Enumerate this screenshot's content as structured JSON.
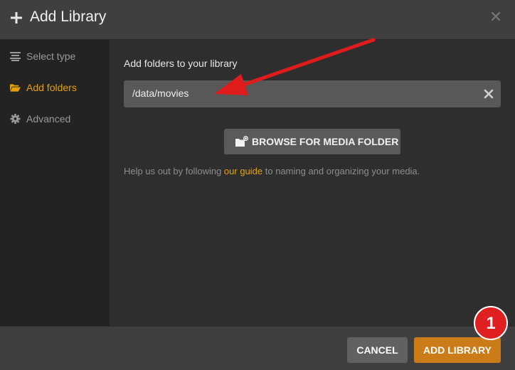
{
  "dialog": {
    "title": "Add Library",
    "title_icon": "plus-icon",
    "close_icon": "close-icon"
  },
  "sidebar": {
    "items": [
      {
        "label": "Select type",
        "icon": "list-icon",
        "active": false
      },
      {
        "label": "Add folders",
        "icon": "folder-open-icon",
        "active": true
      },
      {
        "label": "Advanced",
        "icon": "gear-icon",
        "active": false
      }
    ]
  },
  "main": {
    "heading": "Add folders to your library",
    "folder_path": "/data/movies",
    "clear_icon": "clear-icon",
    "browse_label": "BROWSE FOR MEDIA FOLDER",
    "browse_icon": "add-folder-icon",
    "help_before": "Help us out by following ",
    "help_link": "our guide",
    "help_after": " to naming and organizing your media."
  },
  "footer": {
    "cancel_label": "CANCEL",
    "add_label": "ADD LIBRARY"
  },
  "annotation": {
    "step_number": "1",
    "arrow_icon": "red-arrow"
  },
  "colors": {
    "accent": "#e5a00d",
    "primary_button": "#cc7b19",
    "annotation_red": "#e02020"
  }
}
